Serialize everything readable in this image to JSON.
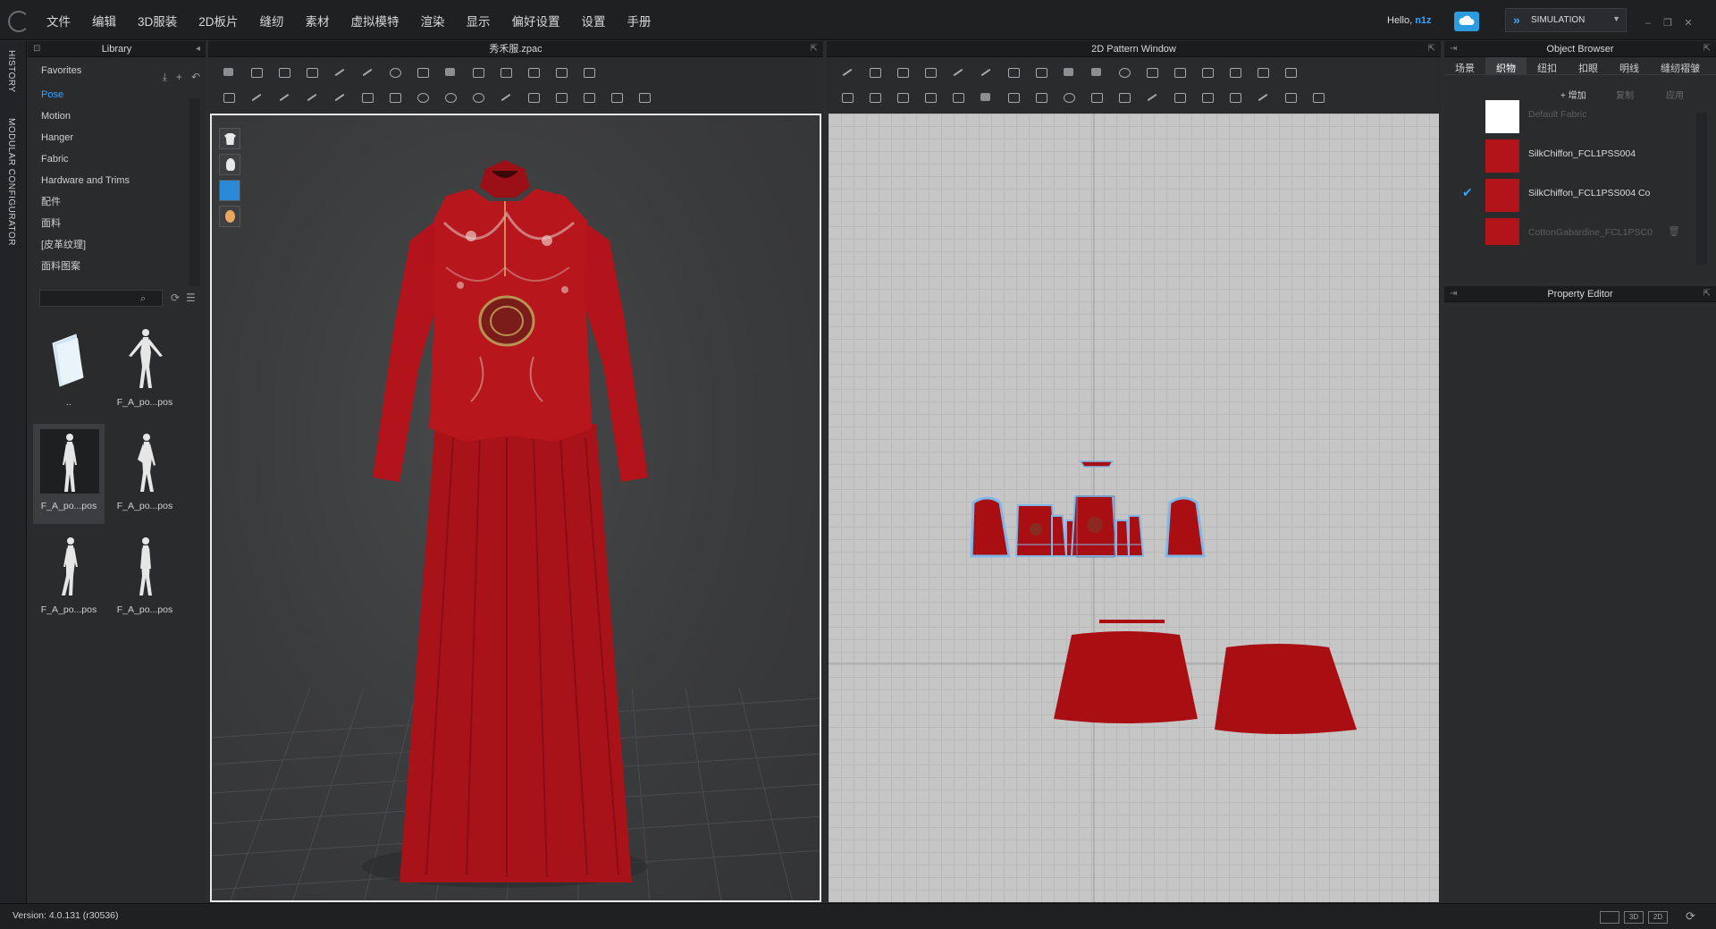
{
  "menubar": {
    "items": [
      "文件",
      "编辑",
      "3D服装",
      "2D板片",
      "缝纫",
      "素材",
      "虚拟模特",
      "渲染",
      "显示",
      "偏好设置",
      "设置",
      "手册"
    ],
    "hello_label": "Hello,",
    "user": "n1z",
    "simulation_label": "SIMULATION"
  },
  "side_tabs": [
    "HISTORY",
    "MODULAR CONFIGURATOR"
  ],
  "library": {
    "title": "Library",
    "favorites": "Favorites",
    "items": [
      "Pose",
      "Motion",
      "Hanger",
      "Fabric",
      "Hardware and Trims",
      "配件",
      "面料",
      "[皮革纹理]",
      "面料图案"
    ],
    "selected": "Pose",
    "search_placeholder": "",
    "thumbnails": [
      {
        "caption": "..",
        "kind": "folder"
      },
      {
        "caption": "F_A_po...pos",
        "kind": "figure"
      },
      {
        "caption": "F_A_po...pos",
        "kind": "figure",
        "selected": true
      },
      {
        "caption": "F_A_po...pos",
        "kind": "figure"
      },
      {
        "caption": "F_A_po...pos",
        "kind": "figure"
      },
      {
        "caption": "F_A_po...pos",
        "kind": "figure"
      }
    ]
  },
  "window3d": {
    "title": "秀禾服.zpac"
  },
  "window2d": {
    "title": "2D Pattern Window"
  },
  "object_browser": {
    "title": "Object Browser",
    "tabs": [
      "场景",
      "织物",
      "纽扣",
      "扣眼",
      "明线",
      "缝纫褶皱"
    ],
    "active_tab": "织物",
    "actions": [
      "+ 增加",
      "复制",
      "应用"
    ],
    "fabrics": [
      {
        "name": "Default Fabric",
        "color": "#ffffff",
        "dim": true
      },
      {
        "name": "SilkChiffon_FCL1PSS004",
        "color": "#b3131a",
        "dim": false
      },
      {
        "name": "SilkChiffon_FCL1PSS004 Co",
        "color": "#b3131a",
        "dim": false,
        "checked": true
      },
      {
        "name": "CottonGabardine_FCL1PSC0",
        "color": "#b3131a",
        "dim": true
      }
    ]
  },
  "property_editor": {
    "title": "Property Editor"
  },
  "statusbar": {
    "version": "Version: 4.0.131 (r30536)",
    "view_buttons": [
      "",
      "3D",
      "2D"
    ]
  },
  "colors": {
    "accent": "#3aa3ff",
    "garment_red": "#b3131a",
    "pattern_red": "#a80e12",
    "outline_blue": "#7fb8e8"
  },
  "icons": [
    "logo",
    "cloud-icon",
    "simulation-chevron-icon",
    "minimize-icon",
    "restore-icon",
    "close-icon",
    "pin-icon",
    "search-icon",
    "refresh-icon",
    "list-view-icon",
    "add-icon",
    "back-icon",
    "download-icon",
    "checkmark-icon"
  ]
}
